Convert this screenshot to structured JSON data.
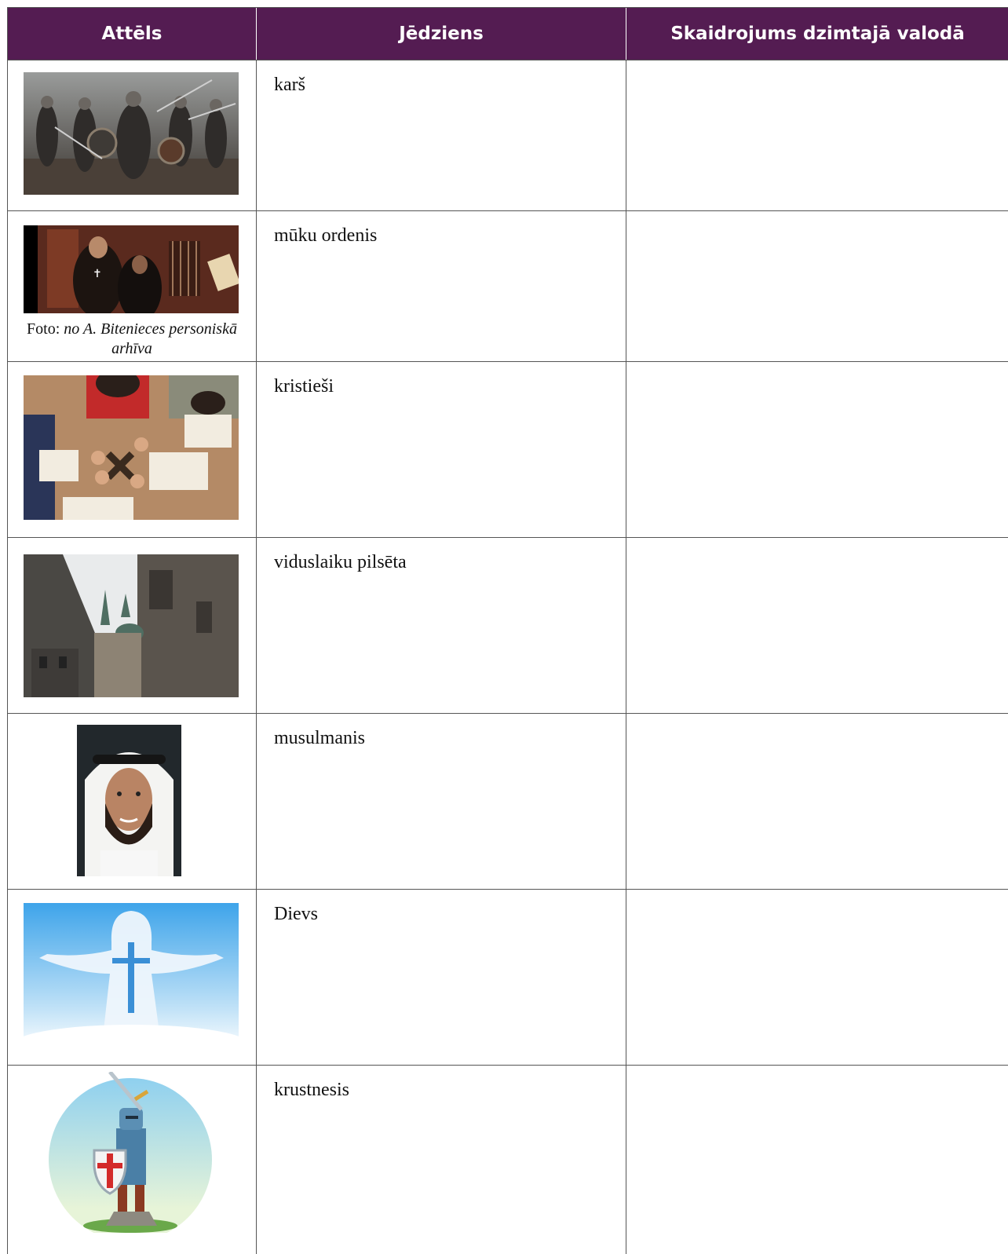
{
  "table": {
    "headers": [
      "Attēls",
      "Jēdziens",
      "Skaidrojums dzimtajā valodā"
    ],
    "rows": [
      {
        "term": "karš",
        "image": "battle-photo",
        "caption_prefix": "",
        "caption_italic": "",
        "explanation": ""
      },
      {
        "term": "mūku ordenis",
        "image": "monks-photo",
        "caption_prefix": "Foto:",
        "caption_italic": "no A. Bitenieces personiskā arhīva",
        "explanation": ""
      },
      {
        "term": "kristieši",
        "image": "praying-hands-photo",
        "caption_prefix": "",
        "caption_italic": "",
        "explanation": ""
      },
      {
        "term": "viduslaiku pilsēta",
        "image": "medieval-city-photo",
        "caption_prefix": "",
        "caption_italic": "",
        "explanation": ""
      },
      {
        "term": "musulmanis",
        "image": "muslim-man-photo",
        "caption_prefix": "",
        "caption_italic": "",
        "explanation": ""
      },
      {
        "term": "Dievs",
        "image": "god-illustration",
        "caption_prefix": "",
        "caption_italic": "",
        "explanation": ""
      },
      {
        "term": "krustnesis",
        "image": "crusader-illustration",
        "caption_prefix": "",
        "caption_italic": "",
        "explanation": ""
      }
    ]
  },
  "colors": {
    "header_bg": "#541c52",
    "header_text": "#ffffff"
  }
}
